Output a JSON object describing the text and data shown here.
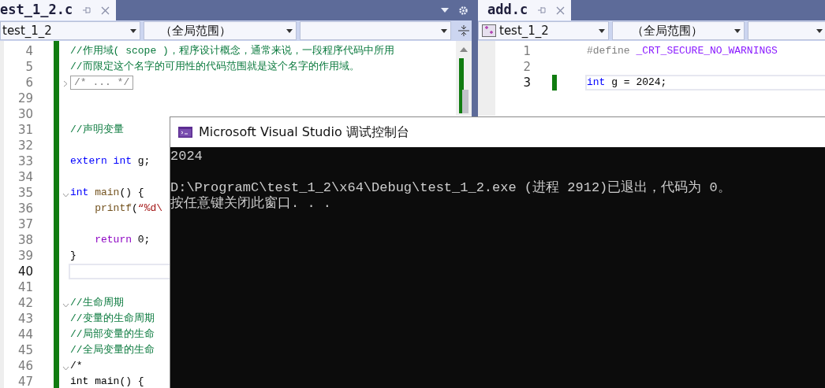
{
  "left_editor": {
    "tab": {
      "label": "est_1_2.c",
      "selected": true
    },
    "nav": {
      "project": "test_1_2",
      "scope": "（全局范围）"
    },
    "lines": [
      {
        "number": "4",
        "current": false,
        "tokens": [
          {
            "text": "//作用域( scope )，程序设计概念，通常来说，一段程序代码中所用",
            "kind": "comment"
          }
        ]
      },
      {
        "number": "5",
        "current": false,
        "tokens": [
          {
            "text": "//而限定这个名字的可用性的代码范围就是这个名字的作用域。",
            "kind": "comment"
          }
        ]
      },
      {
        "number": "6",
        "current": false,
        "expanded": false,
        "tokens": [
          {
            "text": "/* ... */",
            "kind": "collapsed"
          }
        ]
      },
      {
        "number": "29",
        "current": false
      },
      {
        "number": "30",
        "current": false
      },
      {
        "number": "31",
        "current": false,
        "tokens": [
          {
            "text": "//声明变量",
            "kind": "comment"
          }
        ]
      },
      {
        "number": "32",
        "current": false
      },
      {
        "number": "33",
        "current": false,
        "tokens": [
          {
            "text": "extern int",
            "kind": "keyword"
          },
          {
            "text": " g;",
            "kind": "plain"
          }
        ]
      },
      {
        "number": "34",
        "current": false
      },
      {
        "number": "35",
        "current": false,
        "expanded": true,
        "tokens": [
          {
            "text": "int",
            "kind": "keyword"
          },
          {
            "text": " main",
            "kind": "function"
          },
          {
            "text": "() {",
            "kind": "plain"
          }
        ]
      },
      {
        "number": "36",
        "current": false,
        "tokens": [
          {
            "text": "    printf",
            "kind": "function"
          },
          {
            "text": "(",
            "kind": "plain"
          },
          {
            "text": "“%d\\",
            "kind": "string"
          }
        ]
      },
      {
        "number": "37",
        "current": false
      },
      {
        "number": "38",
        "current": false,
        "tokens": [
          {
            "text": "    return",
            "kind": "control"
          },
          {
            "text": " 0;",
            "kind": "plain"
          }
        ]
      },
      {
        "number": "39",
        "current": false,
        "tokens": [
          {
            "text": "}",
            "kind": "plain"
          }
        ]
      },
      {
        "number": "40",
        "current": true
      },
      {
        "number": "41",
        "current": false
      },
      {
        "number": "42",
        "current": false,
        "expanded": true,
        "tokens": [
          {
            "text": "//生命周期",
            "kind": "comment"
          }
        ]
      },
      {
        "number": "43",
        "current": false,
        "tokens": [
          {
            "text": "//变量的生命周期",
            "kind": "comment"
          }
        ]
      },
      {
        "number": "44",
        "current": false,
        "tokens": [
          {
            "text": "//局部变量的生命",
            "kind": "comment"
          }
        ]
      },
      {
        "number": "45",
        "current": false,
        "tokens": [
          {
            "text": "//全局变量的生命",
            "kind": "comment"
          }
        ]
      },
      {
        "number": "46",
        "current": false,
        "expanded": true,
        "tokens": [
          {
            "text": "/*",
            "kind": "plain"
          }
        ]
      },
      {
        "number": "47",
        "current": false,
        "tokens": [
          {
            "text": "int main() {",
            "kind": "plain"
          }
        ]
      }
    ]
  },
  "right_editor": {
    "tab": {
      "label": "add.c",
      "selected": true
    },
    "nav": {
      "project": "test_1_2",
      "scope": "（全局范围）"
    },
    "lines": [
      {
        "number": "1",
        "current": false,
        "changed": false,
        "tokens": [
          {
            "text": "#define",
            "kind": "preprocessor"
          },
          {
            "text": " _CRT_SECURE_NO_WARNINGS",
            "kind": "macro"
          }
        ]
      },
      {
        "number": "2",
        "current": false,
        "changed": false
      },
      {
        "number": "3",
        "current": true,
        "changed": true,
        "tokens": [
          {
            "text": "int",
            "kind": "keyword"
          },
          {
            "text": " g = 2024;",
            "kind": "plain"
          }
        ]
      }
    ]
  },
  "console": {
    "title": "Microsoft Visual Studio 调试控制台",
    "output": [
      "2024"
    ],
    "exit_message": "D:\\ProgramC\\test_1_2\\x64\\Debug\\test_1_2.exe (进程 2912)已退出，代码为 0。",
    "prompt": "按任意键关闭此窗口. . ."
  }
}
